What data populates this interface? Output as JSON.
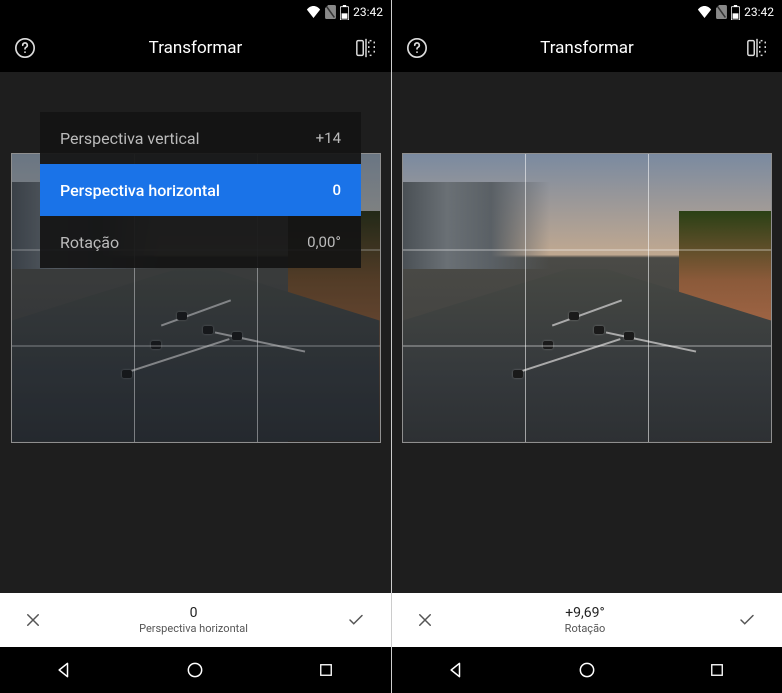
{
  "statusbar": {
    "time": "23:42"
  },
  "left": {
    "toolbar": {
      "title": "Transformar"
    },
    "options": [
      {
        "label": "Perspectiva vertical",
        "value": "+14",
        "selected": false
      },
      {
        "label": "Perspectiva horizontal",
        "value": "0",
        "selected": true
      },
      {
        "label": "Rotação",
        "value": "0,00°",
        "selected": false
      }
    ],
    "action": {
      "value": "0",
      "label": "Perspectiva horizontal"
    }
  },
  "right": {
    "toolbar": {
      "title": "Transformar"
    },
    "action": {
      "value": "+9,69°",
      "label": "Rotação"
    }
  }
}
